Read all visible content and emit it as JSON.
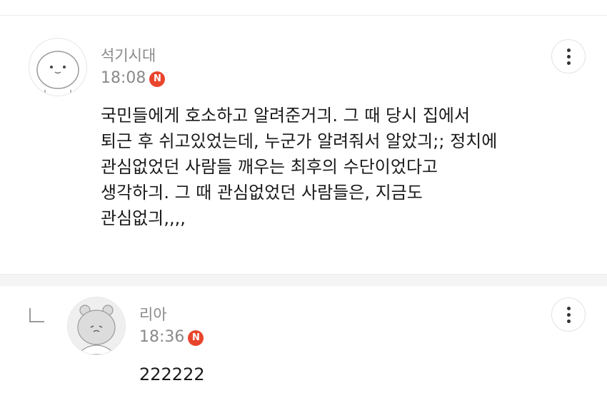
{
  "comments": [
    {
      "nickname": "석기시대",
      "time": "18:08",
      "badge": "N",
      "lines": [
        "국민들에게 호소하고 알려준거긔. 그 때 당시 집에서",
        "퇴근 후 쉬고있었는데, 누군가 알려줘서 알았긔;; 정치에",
        "관심없었던 사람들 깨우는 최후의 수단이었다고",
        "생각하긔. 그 때 관심없었던 사람들은, 지금도",
        "관심없긔,,,,"
      ]
    },
    {
      "nickname": "리아",
      "time": "18:36",
      "badge": "N",
      "lines": [
        "222222"
      ]
    }
  ],
  "icons": {
    "more": "more-vertical-icon",
    "reply": "reply-arrow-icon",
    "badge": "new-badge-icon"
  },
  "colors": {
    "badge": "#e8452c",
    "meta_text": "#8a8a8a",
    "body_text": "#1a1a1a",
    "separator": "#f4f4f4"
  }
}
